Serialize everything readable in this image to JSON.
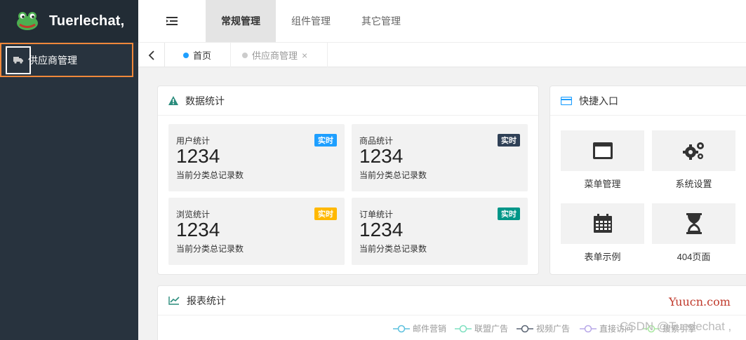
{
  "app": {
    "title": "Tuerlechat,"
  },
  "sidebar": {
    "items": [
      {
        "label": "供应商管理",
        "icon": "truck-icon"
      }
    ]
  },
  "header": {
    "tabs": [
      {
        "label": "常规管理",
        "active": true
      },
      {
        "label": "组件管理",
        "active": false
      },
      {
        "label": "其它管理",
        "active": false
      }
    ]
  },
  "tabbar": {
    "tabs": [
      {
        "label": "首页",
        "dot_color": "#1e9fff"
      },
      {
        "label": "供应商管理",
        "dot_color": "#cccccc",
        "close": "×"
      }
    ]
  },
  "stats": {
    "title": "数据统计",
    "items": [
      {
        "title": "用户统计",
        "badge": "实时",
        "badge_color": "#1e9fff",
        "value": "1234",
        "desc": "当前分类总记录数"
      },
      {
        "title": "商品统计",
        "badge": "实时",
        "badge_color": "#2f4056",
        "value": "1234",
        "desc": "当前分类总记录数"
      },
      {
        "title": "浏览统计",
        "badge": "实时",
        "badge_color": "#ffb800",
        "value": "1234",
        "desc": "当前分类总记录数"
      },
      {
        "title": "订单统计",
        "badge": "实时",
        "badge_color": "#009688",
        "value": "1234",
        "desc": "当前分类总记录数"
      }
    ]
  },
  "quick": {
    "title": "快捷入口",
    "items": [
      {
        "label": "菜单管理",
        "icon": "window-icon"
      },
      {
        "label": "系统设置",
        "icon": "gears-icon"
      },
      {
        "label": "表单示例",
        "icon": "calendar-icon"
      },
      {
        "label": "404页面",
        "icon": "hourglass-icon"
      }
    ]
  },
  "report": {
    "title": "报表统计",
    "legend": [
      {
        "name": "邮件营销",
        "color": "#5bc0de"
      },
      {
        "name": "联盟广告",
        "color": "#7ee0c0"
      },
      {
        "name": "视频广告",
        "color": "#5a6473"
      },
      {
        "name": "直接访问",
        "color": "#b8a8e8"
      },
      {
        "name": "搜索引擎",
        "color": "#a8e8a0"
      }
    ]
  },
  "watermarks": {
    "site": "Yuucn.com",
    "csdn": "CSDN @Tuerlechat ,"
  }
}
